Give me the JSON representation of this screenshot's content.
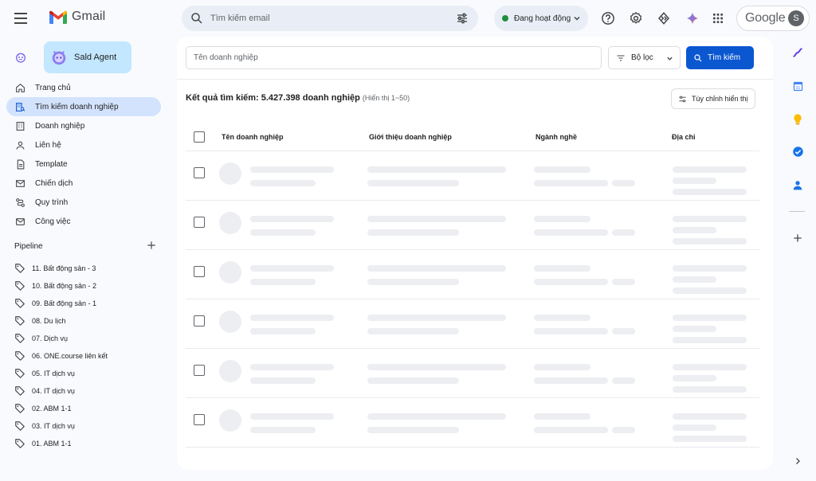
{
  "header": {
    "app_name": "Gmail",
    "search_placeholder": "Tìm kiếm email",
    "status_label": "Đang hoạt động",
    "google_word": "Google",
    "avatar_letter": "S"
  },
  "sidebar": {
    "agent_label": "Sald Agent",
    "nav": [
      {
        "label": "Trang chủ",
        "icon": "home-icon",
        "active": false
      },
      {
        "label": "Tìm kiếm doanh nghiệp",
        "icon": "building-search-icon",
        "active": true
      },
      {
        "label": "Doanh nghiệp",
        "icon": "building-icon",
        "active": false
      },
      {
        "label": "Liên hệ",
        "icon": "person-icon",
        "active": false
      },
      {
        "label": "Template",
        "icon": "document-icon",
        "active": false
      },
      {
        "label": "Chiến dịch",
        "icon": "mail-icon",
        "active": false
      },
      {
        "label": "Quy trình",
        "icon": "workflow-icon",
        "active": false
      },
      {
        "label": "Công việc",
        "icon": "task-icon",
        "active": false
      }
    ],
    "pipeline_title": "Pipeline",
    "pipelines": [
      "11. Bất động sản - 3",
      "10. Bất động sản - 2",
      "09. Bất động sản - 1",
      "08. Du lịch",
      "07. Dịch vụ",
      "06. ONE.course liên kết",
      "05. IT dịch vụ",
      "04. IT dịch vụ",
      "02. ABM 1-1",
      "03. IT dịch vụ",
      "01. ABM 1-1"
    ]
  },
  "main": {
    "name_placeholder": "Tên doanh nghiệp",
    "filter_label": "Bộ lọc",
    "search_label": "Tìm kiếm",
    "result_title": "Kết quả tìm kiếm: 5.427.398 doanh nghiệp",
    "result_sub": "(Hiển thị 1~50)",
    "custom_label": "Tùy chỉnh hiển thị",
    "columns": [
      "Tên doanh nghiệp",
      "Giới thiệu doanh nghiệp",
      "Ngành nghề",
      "Địa chỉ"
    ],
    "skeleton_rows": 6
  },
  "colors": {
    "accent": "#0b57d0",
    "active_nav": "#d3e3fd",
    "agent_card": "#c2e7ff",
    "status_dot": "#1e8e3e"
  }
}
